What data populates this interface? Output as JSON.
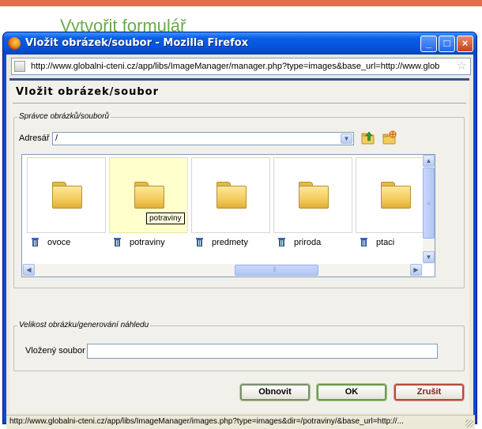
{
  "background": {
    "heading": "Vytvořit formulář"
  },
  "window": {
    "title": "Vložit obrázek/soubor - Mozilla Firefox",
    "accent": "#0a49d6"
  },
  "address_bar": {
    "url": "http://www.globalni-cteni.cz/app/libs/ImageManager/manager.php?type=images&base_url=http://www.glob"
  },
  "dialog": {
    "title": "Vložit obrázek/soubor",
    "manager": {
      "legend": "Správce obrázků/souborů",
      "dir_label": "Adresář",
      "dir_value": "/",
      "items": [
        {
          "name": "ovoce",
          "icon": "folder-icon"
        },
        {
          "name": "potraviny",
          "icon": "folder-icon",
          "highlighted": true
        },
        {
          "name": "predmety",
          "icon": "folder-icon"
        },
        {
          "name": "priroda",
          "icon": "folder-icon"
        },
        {
          "name": "ptaci",
          "icon": "folder-icon"
        }
      ],
      "tooltip": "potraviny"
    },
    "size_section": {
      "legend": "Velikost obrázku/generování náhledu",
      "file_label": "Vložený soubor",
      "file_value": ""
    },
    "buttons": {
      "refresh": "Obnovit",
      "ok": "OK",
      "cancel": "Zrušit"
    }
  },
  "status": {
    "text": "http://www.globalni-cteni.cz/app/libs/ImageManager/images.php?type=images&dir=/potraviny/&base_url=http://..."
  }
}
